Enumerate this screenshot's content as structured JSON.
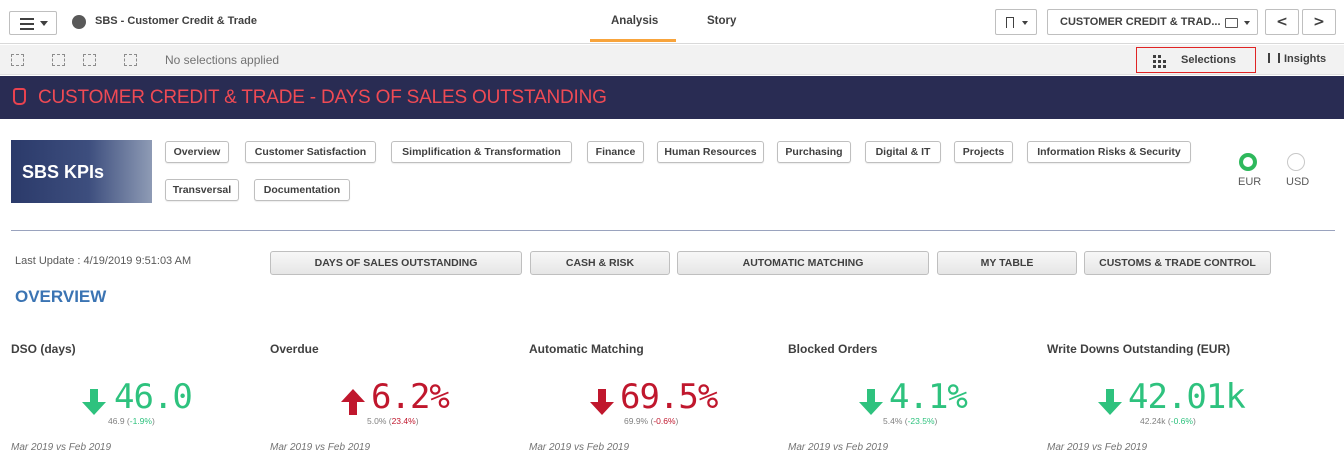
{
  "toolbar": {
    "app_title": "SBS - Customer Credit & Trade",
    "tabs": [
      {
        "label": "Analysis",
        "active": true
      },
      {
        "label": "Story",
        "active": false
      }
    ],
    "sheet_name": "CUSTOMER CREDIT & TRAD...",
    "prev_label": "<",
    "next_label": ">",
    "accent_color": "#f8a43c"
  },
  "selection_bar": {
    "status_text": "No selections applied",
    "selections_label": "Selections",
    "insights_label": "Insights"
  },
  "banner": {
    "title": "CUSTOMER CREDIT & TRADE - DAYS OF SALES OUTSTANDING",
    "background": "#292c53",
    "title_color": "#ef4a54"
  },
  "logo_text": "SBS KPIs",
  "nav_buttons": [
    "Overview",
    "Customer Satisfaction",
    "Simplification & Transformation",
    "Finance",
    "Human Resources",
    "Purchasing",
    "Digital & IT",
    "Projects",
    "Information Risks & Security",
    "Transversal",
    "Documentation"
  ],
  "currency": {
    "options": [
      {
        "label": "EUR",
        "selected": true
      },
      {
        "label": "USD",
        "selected": false
      }
    ]
  },
  "last_update": "Last Update : 4/19/2019 9:51:03 AM",
  "section_buttons": [
    "DAYS OF SALES OUTSTANDING",
    "CASH & RISK",
    "AUTOMATIC MATCHING",
    "MY TABLE",
    "CUSTOMS & TRADE CONTROL"
  ],
  "section_heading": "OVERVIEW",
  "colors": {
    "good": "#2ec27e",
    "bad": "#c0172d",
    "sub_good": "#2ec27e",
    "sub_bad": "#c0172d"
  },
  "kpis": [
    {
      "title": "DSO (days)",
      "value": "46.0",
      "trend": "down",
      "status": "good",
      "sub_prev": "46.9",
      "sub_change": "-1.9%",
      "period": "Mar 2019 vs Feb 2019"
    },
    {
      "title": "Overdue",
      "value": "6.2%",
      "trend": "up",
      "status": "bad",
      "sub_prev": "5.0%",
      "sub_change": "23.4%",
      "period": "Mar 2019 vs Feb 2019"
    },
    {
      "title": "Automatic Matching",
      "value": "69.5%",
      "trend": "down",
      "status": "bad",
      "sub_prev": "69.9%",
      "sub_change": "-0.6%",
      "period": "Mar 2019 vs Feb 2019"
    },
    {
      "title": "Blocked Orders",
      "value": "4.1%",
      "trend": "down",
      "status": "good",
      "sub_prev": "5.4%",
      "sub_change": "-23.5%",
      "period": "Mar 2019 vs Feb 2019"
    },
    {
      "title": "Write Downs Outstanding (EUR)",
      "value": "42.01k",
      "trend": "down",
      "status": "good",
      "sub_prev": "42.24k",
      "sub_change": "-0.6%",
      "period": "Mar 2019 vs Feb 2019"
    }
  ]
}
